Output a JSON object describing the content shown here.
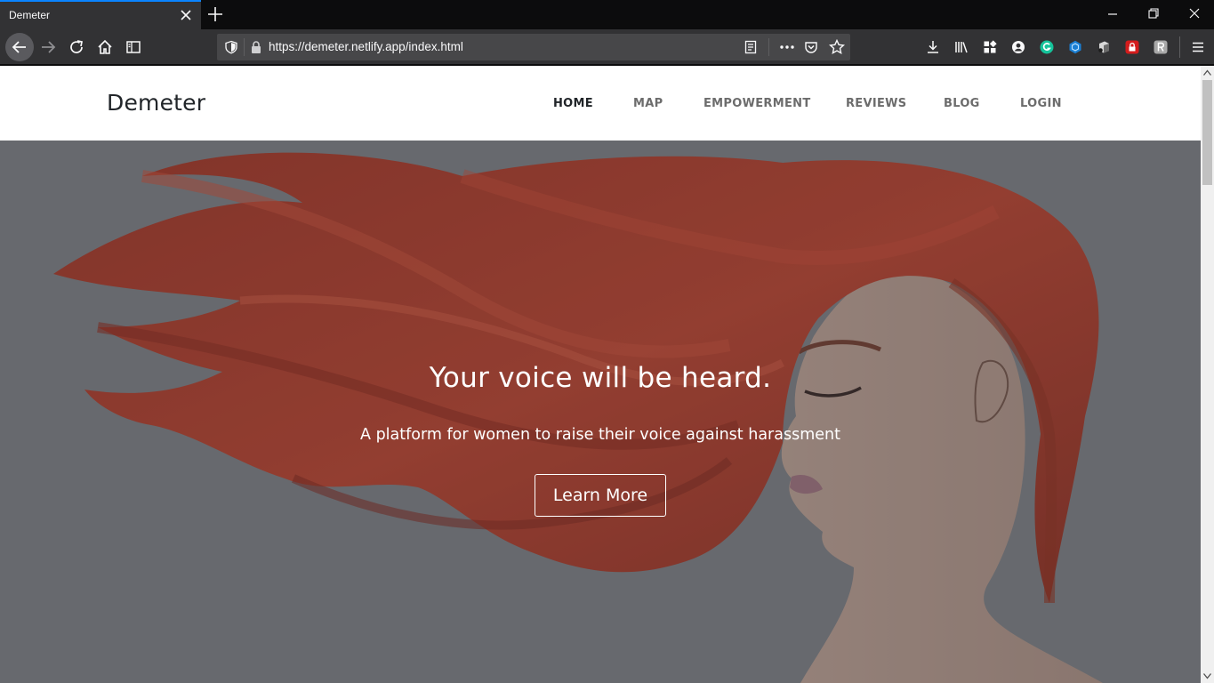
{
  "browser": {
    "tab_title": "Demeter",
    "url": "https://demeter.netlify.app/index.html",
    "accent_color": "#0a84ff",
    "toolbar_icons": [
      "back-icon",
      "forward-icon",
      "reload-icon",
      "home-icon",
      "sidebar-icon"
    ],
    "extension_icons": [
      "download-icon",
      "library-icon",
      "apps-icon",
      "account-icon",
      "grammarly-icon",
      "cube-icon",
      "ghost-icon",
      "lock-extension-icon",
      "r-extension-icon",
      "menu-icon"
    ]
  },
  "site": {
    "logo": "Demeter",
    "nav": [
      {
        "label": "HOME",
        "active": true
      },
      {
        "label": "MAP",
        "active": false
      },
      {
        "label": "EMPOWERMENT",
        "active": false
      },
      {
        "label": "REVIEWS",
        "active": false
      },
      {
        "label": "BLOG",
        "active": false
      },
      {
        "label": "LOGIN",
        "active": false
      }
    ]
  },
  "hero": {
    "title": "Your voice will be heard.",
    "subtitle": "A platform for women to raise their voice against harassment",
    "button": "Learn More",
    "hair_color": "#b3321d",
    "overlay_color": "#74777b"
  }
}
